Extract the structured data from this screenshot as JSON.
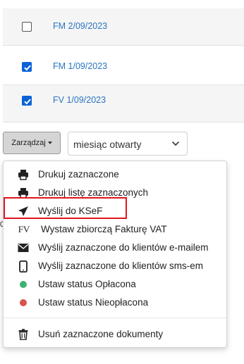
{
  "documents": [
    {
      "number": "FM 2/09/2023",
      "checked": false
    },
    {
      "number": "FM 1/09/2023",
      "checked": true
    },
    {
      "number": "FV 1/09/2023",
      "checked": true
    }
  ],
  "toolbar": {
    "manage_label": "Zarządzaj",
    "period_select_value": "miesiąc otwarty"
  },
  "menu": {
    "items": [
      {
        "label": "Drukuj zaznaczone",
        "icon": "printer-icon"
      },
      {
        "label": "Drukuj listę zaznaczonych",
        "icon": "printer-icon"
      },
      {
        "label": "Wyślij do KSeF",
        "icon": "send-icon"
      },
      {
        "label": "Wystaw zbiorczą Fakturę VAT",
        "icon": "fv-text-icon",
        "icon_text": "FV"
      },
      {
        "label": "Wyślij zaznaczone do klientów e-mailem",
        "icon": "envelope-icon"
      },
      {
        "label": "Wyślij zaznaczone do klientów sms-em",
        "icon": "mobile-phone-icon"
      },
      {
        "label": "Ustaw status Opłacona",
        "icon": "green-dot-icon",
        "color": "#3cb371"
      },
      {
        "label": "Ustaw status Nieopłacona",
        "icon": "red-dot-icon",
        "color": "#d9534f"
      },
      {
        "label": "Usuń zaznaczone dokumenty",
        "icon": "trash-icon"
      }
    ]
  },
  "stray_text": "0",
  "colors": {
    "accent": "#2a74c2",
    "checkbox": "#0b63d6",
    "highlight": "#e0161b"
  }
}
